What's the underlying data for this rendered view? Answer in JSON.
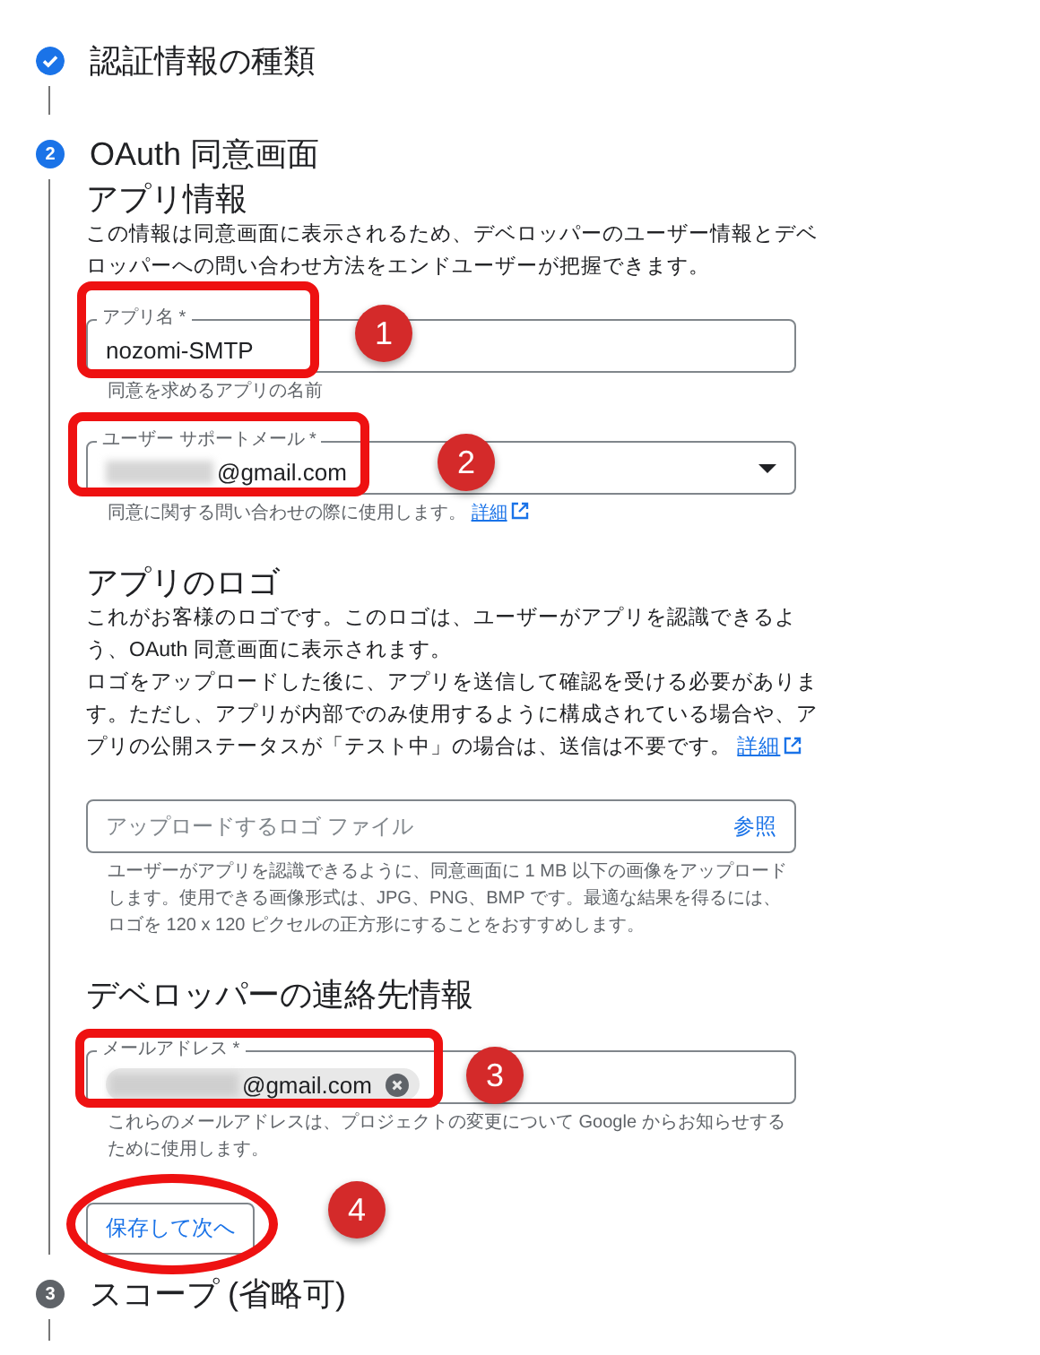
{
  "steps": [
    {
      "completed": true,
      "active": false,
      "title": "認証情報の種類"
    },
    {
      "completed": false,
      "active": true,
      "number": "2",
      "title": "OAuth 同意画面",
      "sections": [
        {
          "heading": "アプリ情報",
          "description": "この情報は同意画面に表示されるため、デベロッパーのユーザー情報とデベロッパーへの問い合わせ方法をエンドユーザーが把握できます。",
          "fields": [
            {
              "kind": "text",
              "label": "アプリ名 *",
              "value": "nozomi-SMTP",
              "helper": "同意を求めるアプリの名前"
            },
            {
              "kind": "select",
              "label": "ユーザー サポートメール *",
              "value": "@gmail.com",
              "redacted": true,
              "helper": "同意に関する問い合わせの際に使用します。",
              "link": "詳細"
            }
          ]
        },
        {
          "heading": "アプリのロゴ",
          "paragraphs": [
            "これがお客様のロゴです。このロゴは、ユーザーがアプリを認識できるよう、OAuth 同意画面に表示されます。",
            "ロゴをアップロードした後に、アプリを送信して確認を受ける必要があります。ただし、アプリが内部でのみ使用するように構成されている場合や、アプリの公開ステータスが「テスト中」の場合は、送信は不要です。"
          ],
          "link": "詳細",
          "fields": [
            {
              "kind": "file",
              "placeholder": "アップロードするロゴ ファイル",
              "action": "参照",
              "helper": "ユーザーがアプリを認識できるように、同意画面に 1 MB 以下の画像をアップロードします。使用できる画像形式は、JPG、PNG、BMP です。最適な結果を得るには、ロゴを 120 x 120 ピクセルの正方形にすることをおすすめします。"
            }
          ]
        },
        {
          "heading": "デベロッパーの連絡先情報",
          "fields": [
            {
              "kind": "chips",
              "label": "メールアドレス *",
              "chips": [
                {
                  "value": "@gmail.com",
                  "redacted": true
                }
              ],
              "helper": "これらのメールアドレスは、プロジェクトの変更について Google からお知らせするために使用します。"
            }
          ]
        }
      ],
      "button": "保存して次へ"
    },
    {
      "completed": false,
      "active": false,
      "number": "3",
      "title": "スコープ (省略可)"
    }
  ],
  "annotations": [
    {
      "kind": "box",
      "label": "1"
    },
    {
      "kind": "box",
      "label": "2"
    },
    {
      "kind": "box",
      "label": "3"
    },
    {
      "kind": "ellipse",
      "label": "4"
    }
  ]
}
